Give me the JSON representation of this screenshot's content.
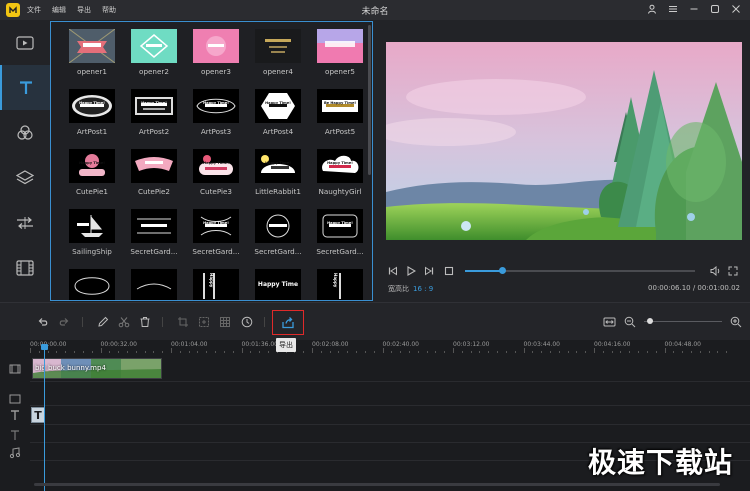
{
  "window": {
    "title": "未命名",
    "logo_glyph": "✎"
  },
  "menu": [
    "文件",
    "编辑",
    "导出",
    "帮助"
  ],
  "templates": [
    {
      "label": "opener1",
      "style": "opener1"
    },
    {
      "label": "opener2",
      "style": "opener2"
    },
    {
      "label": "opener3",
      "style": "opener3"
    },
    {
      "label": "opener4",
      "style": "opener4"
    },
    {
      "label": "opener5",
      "style": "opener5"
    },
    {
      "label": "ArtPost1",
      "style": "art1"
    },
    {
      "label": "ArtPost2",
      "style": "art2"
    },
    {
      "label": "ArtPost3",
      "style": "art3"
    },
    {
      "label": "ArtPost4",
      "style": "art4"
    },
    {
      "label": "ArtPost5",
      "style": "art5"
    },
    {
      "label": "CutePie1",
      "style": "cute1"
    },
    {
      "label": "CutePie2",
      "style": "cute2"
    },
    {
      "label": "CutePie3",
      "style": "cute3"
    },
    {
      "label": "LittleRabbit1",
      "style": "rabbit"
    },
    {
      "label": "NaughtyGirl",
      "style": "naughty"
    },
    {
      "label": "SailingShip",
      "style": "sail"
    },
    {
      "label": "SecretGard...",
      "style": "sg1"
    },
    {
      "label": "SecretGard...",
      "style": "sg2"
    },
    {
      "label": "SecretGard...",
      "style": "sg3"
    },
    {
      "label": "SecretGard...",
      "style": "sg4"
    },
    {
      "label": "",
      "style": "r5a"
    },
    {
      "label": "",
      "style": "r5b"
    },
    {
      "label": "",
      "style": "r5c"
    },
    {
      "label": "",
      "style": "r5d"
    },
    {
      "label": "",
      "style": "r5e"
    }
  ],
  "thumb_text": {
    "happy_time": "Happy Time!",
    "happy_time_plain": "Happy Time",
    "be_happy": "Be Happy Time!",
    "happy_vertical": "Happy",
    "text_filler": "Text Text Text Text"
  },
  "preview": {
    "ratio_label": "宽高比",
    "ratio_value": "16 : 9",
    "current_time": "00:00:06.10",
    "total_time": "00:01:00.02",
    "progress": 0.16
  },
  "toolbar": {
    "export_tooltip": "导出"
  },
  "timeline": {
    "ticks": [
      "00:00:00.00",
      "00:00:32.00",
      "00:01:04.00",
      "00:01:36.00",
      "00:02:08.00",
      "00:02:40.00",
      "00:03:12.00",
      "00:03:44.00",
      "00:04:16.00",
      "00:04:48.00"
    ],
    "clip_label": "big buck bunny.mp4",
    "text_clip_glyph": "T",
    "zoom": 0.08
  },
  "watermark": "极速下载站",
  "colors": {
    "accent": "#3a9bdc",
    "highlight": "#e02a2a",
    "logo": "#f3c613"
  }
}
